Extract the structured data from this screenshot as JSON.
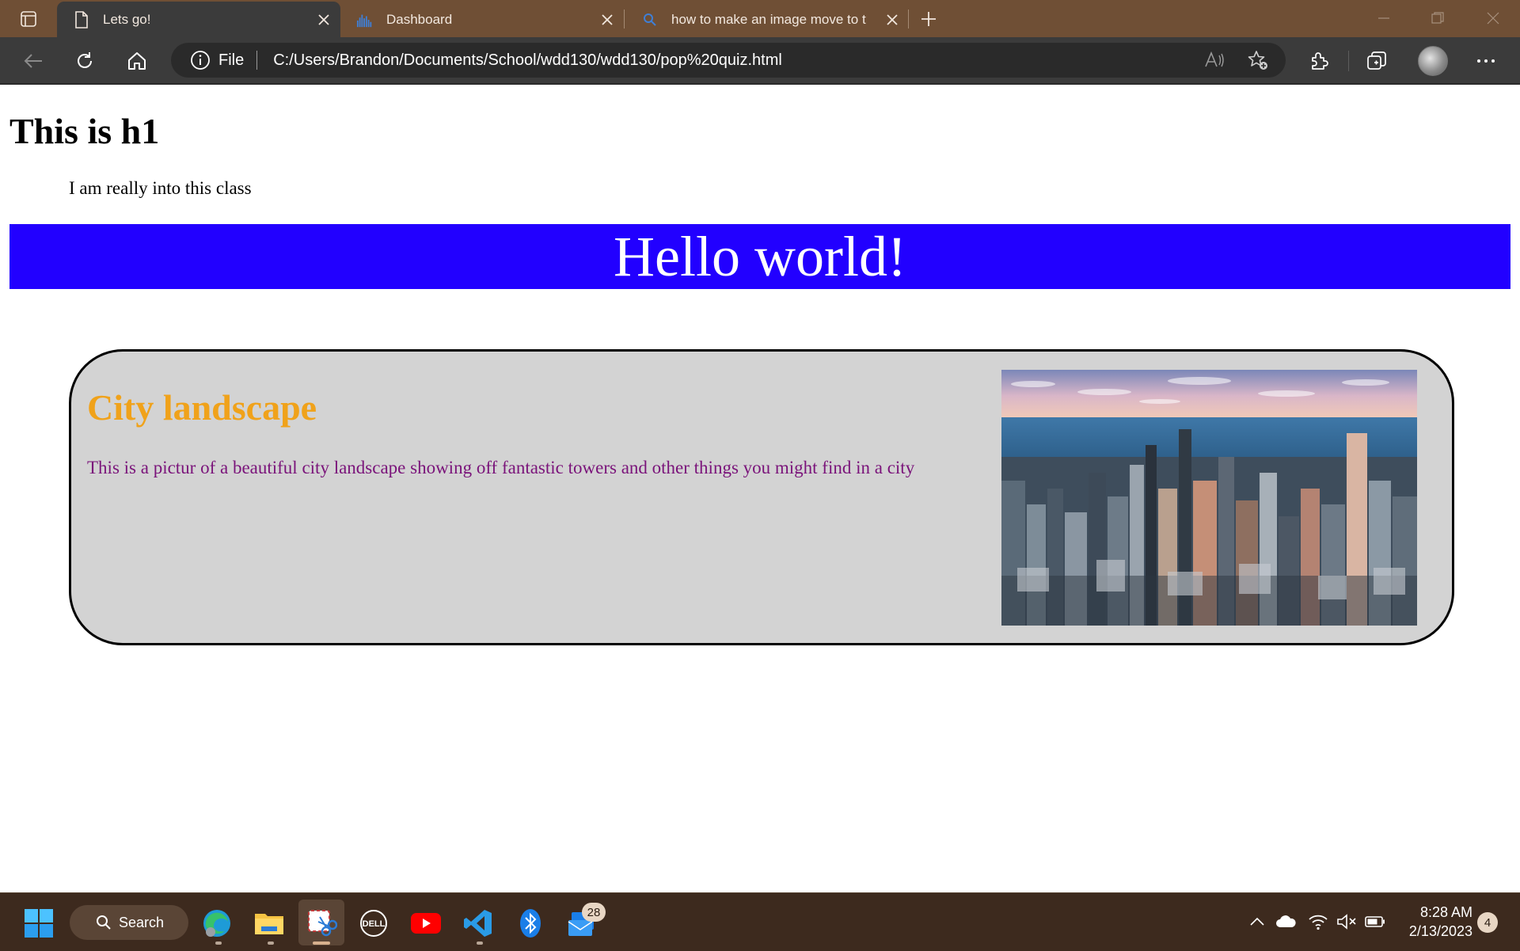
{
  "browser": {
    "tabs": [
      {
        "title": "Lets go!",
        "icon": "page-icon",
        "active": true
      },
      {
        "title": "Dashboard",
        "icon": "dashboard-icon",
        "active": false
      },
      {
        "title": "how to make an image move to t",
        "icon": "search-icon",
        "active": false
      }
    ],
    "address": {
      "scheme_label": "File",
      "url": "C:/Users/Brandon/Documents/School/wdd130/wdd130/pop%20quiz.html"
    }
  },
  "page": {
    "h1": "This is h1",
    "intro": "I am really into this class",
    "hello": "Hello world!",
    "card": {
      "title": "City landscape",
      "text": "This is a pictur of a beautiful city landscape showing off fantastic towers and other things you might find in a city",
      "image_icon": "city-skyline-image"
    }
  },
  "taskbar": {
    "search_label": "Search",
    "mail_badge": "28",
    "time": "8:28 AM",
    "date": "2/13/2023",
    "notifications": "4"
  },
  "colors": {
    "tabstrip": "#6f4f35",
    "toolbar": "#3b3b3b",
    "hello_bg": "#2200ff",
    "card_bg": "#d3d3d3",
    "card_title": "#f0a21a",
    "card_text": "#7a137a",
    "taskbar": "#3d2a1e"
  }
}
